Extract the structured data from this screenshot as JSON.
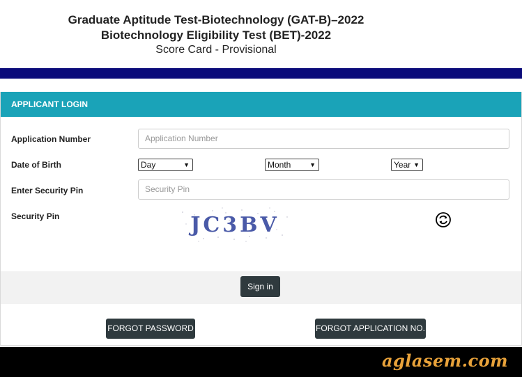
{
  "header": {
    "title_line1": "Graduate Aptitude Test-Biotechnology (GAT-B)–2022",
    "title_line2": "Biotechnology Eligibility Test (BET)-2022",
    "subtitle": "Score Card - Provisional"
  },
  "panel": {
    "heading": "APPLICANT LOGIN",
    "application_number": {
      "label": "Application Number",
      "placeholder": "Application Number"
    },
    "dob": {
      "label": "Date of Birth",
      "day": "Day",
      "month": "Month",
      "year": "Year"
    },
    "security_pin_input": {
      "label": "Enter Security Pin",
      "placeholder": "Security Pin"
    },
    "captcha": {
      "label": "Security Pin",
      "text": "JC3BV"
    },
    "sign_in": "Sign in"
  },
  "links": {
    "forgot_password": "FORGOT PASSWORD",
    "forgot_application": "FORGOT APPLICATION NO."
  },
  "footer": {
    "brand": "aglasem.com"
  },
  "colors": {
    "navbar": "#0b0b7a",
    "panel_head": "#1aa3b8",
    "button": "#2f3a3e",
    "brand": "#e8a23a"
  }
}
